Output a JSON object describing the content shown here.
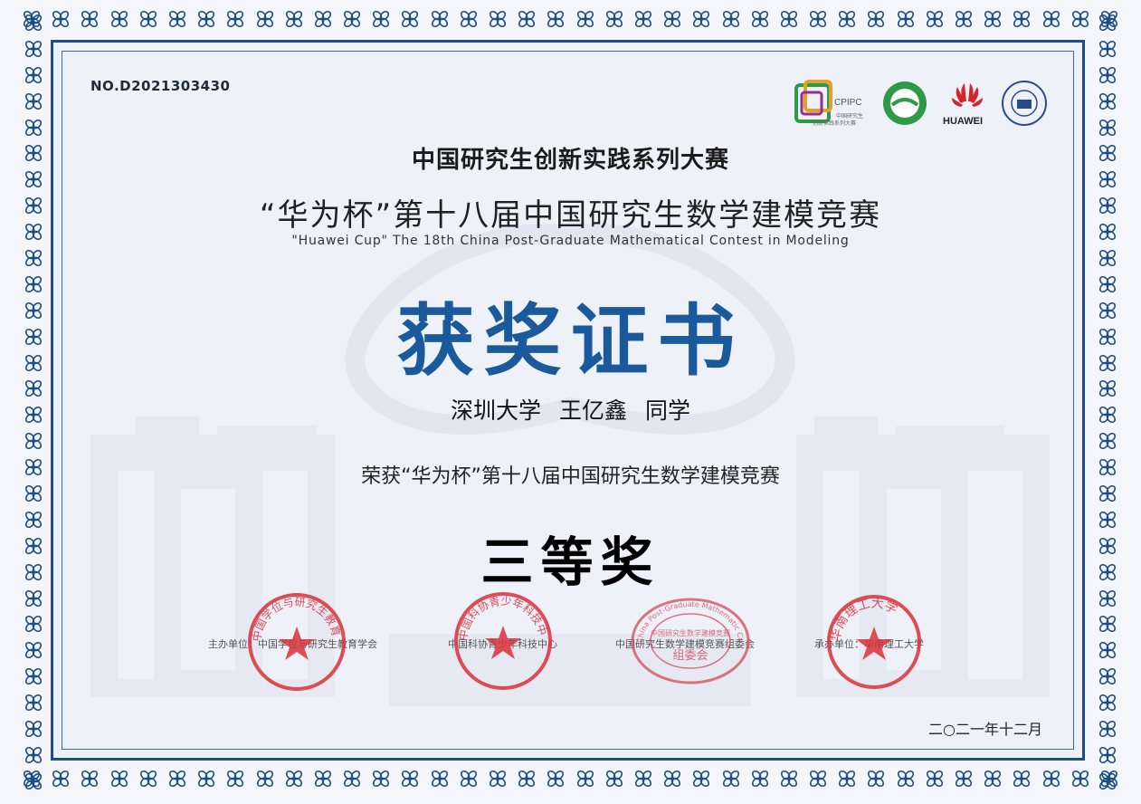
{
  "certificate": {
    "number": "NO.D2021303430",
    "headline": "中国研究生创新实践系列大赛",
    "contest_cn": "“华为杯”第十八届中国研究生数学建模竞赛",
    "contest_en": "\"Huawei Cup\" The 18th China Post-Graduate Mathematical Contest in Modeling",
    "title": "获奖证书",
    "recipient": {
      "university": "深圳大学",
      "name": "王亿鑫",
      "suffix": "同学"
    },
    "award_line": "荣获“华为杯”第十八届中国研究生数学建模竞赛",
    "prize": "三等奖",
    "date": "二○二一年十二月"
  },
  "logos": {
    "cpipc": {
      "label": "CPIPC",
      "sub1": "中国研究生",
      "sub2": "创新实践系列大赛",
      "icon": "cpipc-logo"
    },
    "society": {
      "icon": "society-logo"
    },
    "huawei": {
      "label": "HUAWEI",
      "icon": "huawei-logo"
    },
    "university": {
      "icon": "university-seal-logo"
    }
  },
  "organizers": [
    {
      "text": "主办单位：中国学位与研究生教育学会"
    },
    {
      "text": "中国科协青少年科技中心"
    },
    {
      "text": "中国研究生数学建模竞赛组委会"
    },
    {
      "text": "承办单位：华南理工大学"
    }
  ],
  "stamps": [
    {
      "icon": "red-seal-degree-society",
      "arc_text": "中国学位与研究生教育学会",
      "color": "#d9303a"
    },
    {
      "icon": "red-seal-youth-center",
      "arc_text": "中国科协青少年科技中心",
      "color": "#d9303a"
    },
    {
      "icon": "red-seal-organizing-committee",
      "arc_text": "China Post-Graduate Mathematic Contest in Modeling",
      "inner_text": "中国研究生数学建模竞赛",
      "center_text": "组委会",
      "color": "#d24a5a"
    },
    {
      "icon": "red-seal-scut",
      "arc_text": "华南理工大学",
      "color": "#d9303a"
    }
  ],
  "colors": {
    "border": "#1d4f86",
    "title": "#1a5a9c",
    "stamp": "#d9303a"
  }
}
